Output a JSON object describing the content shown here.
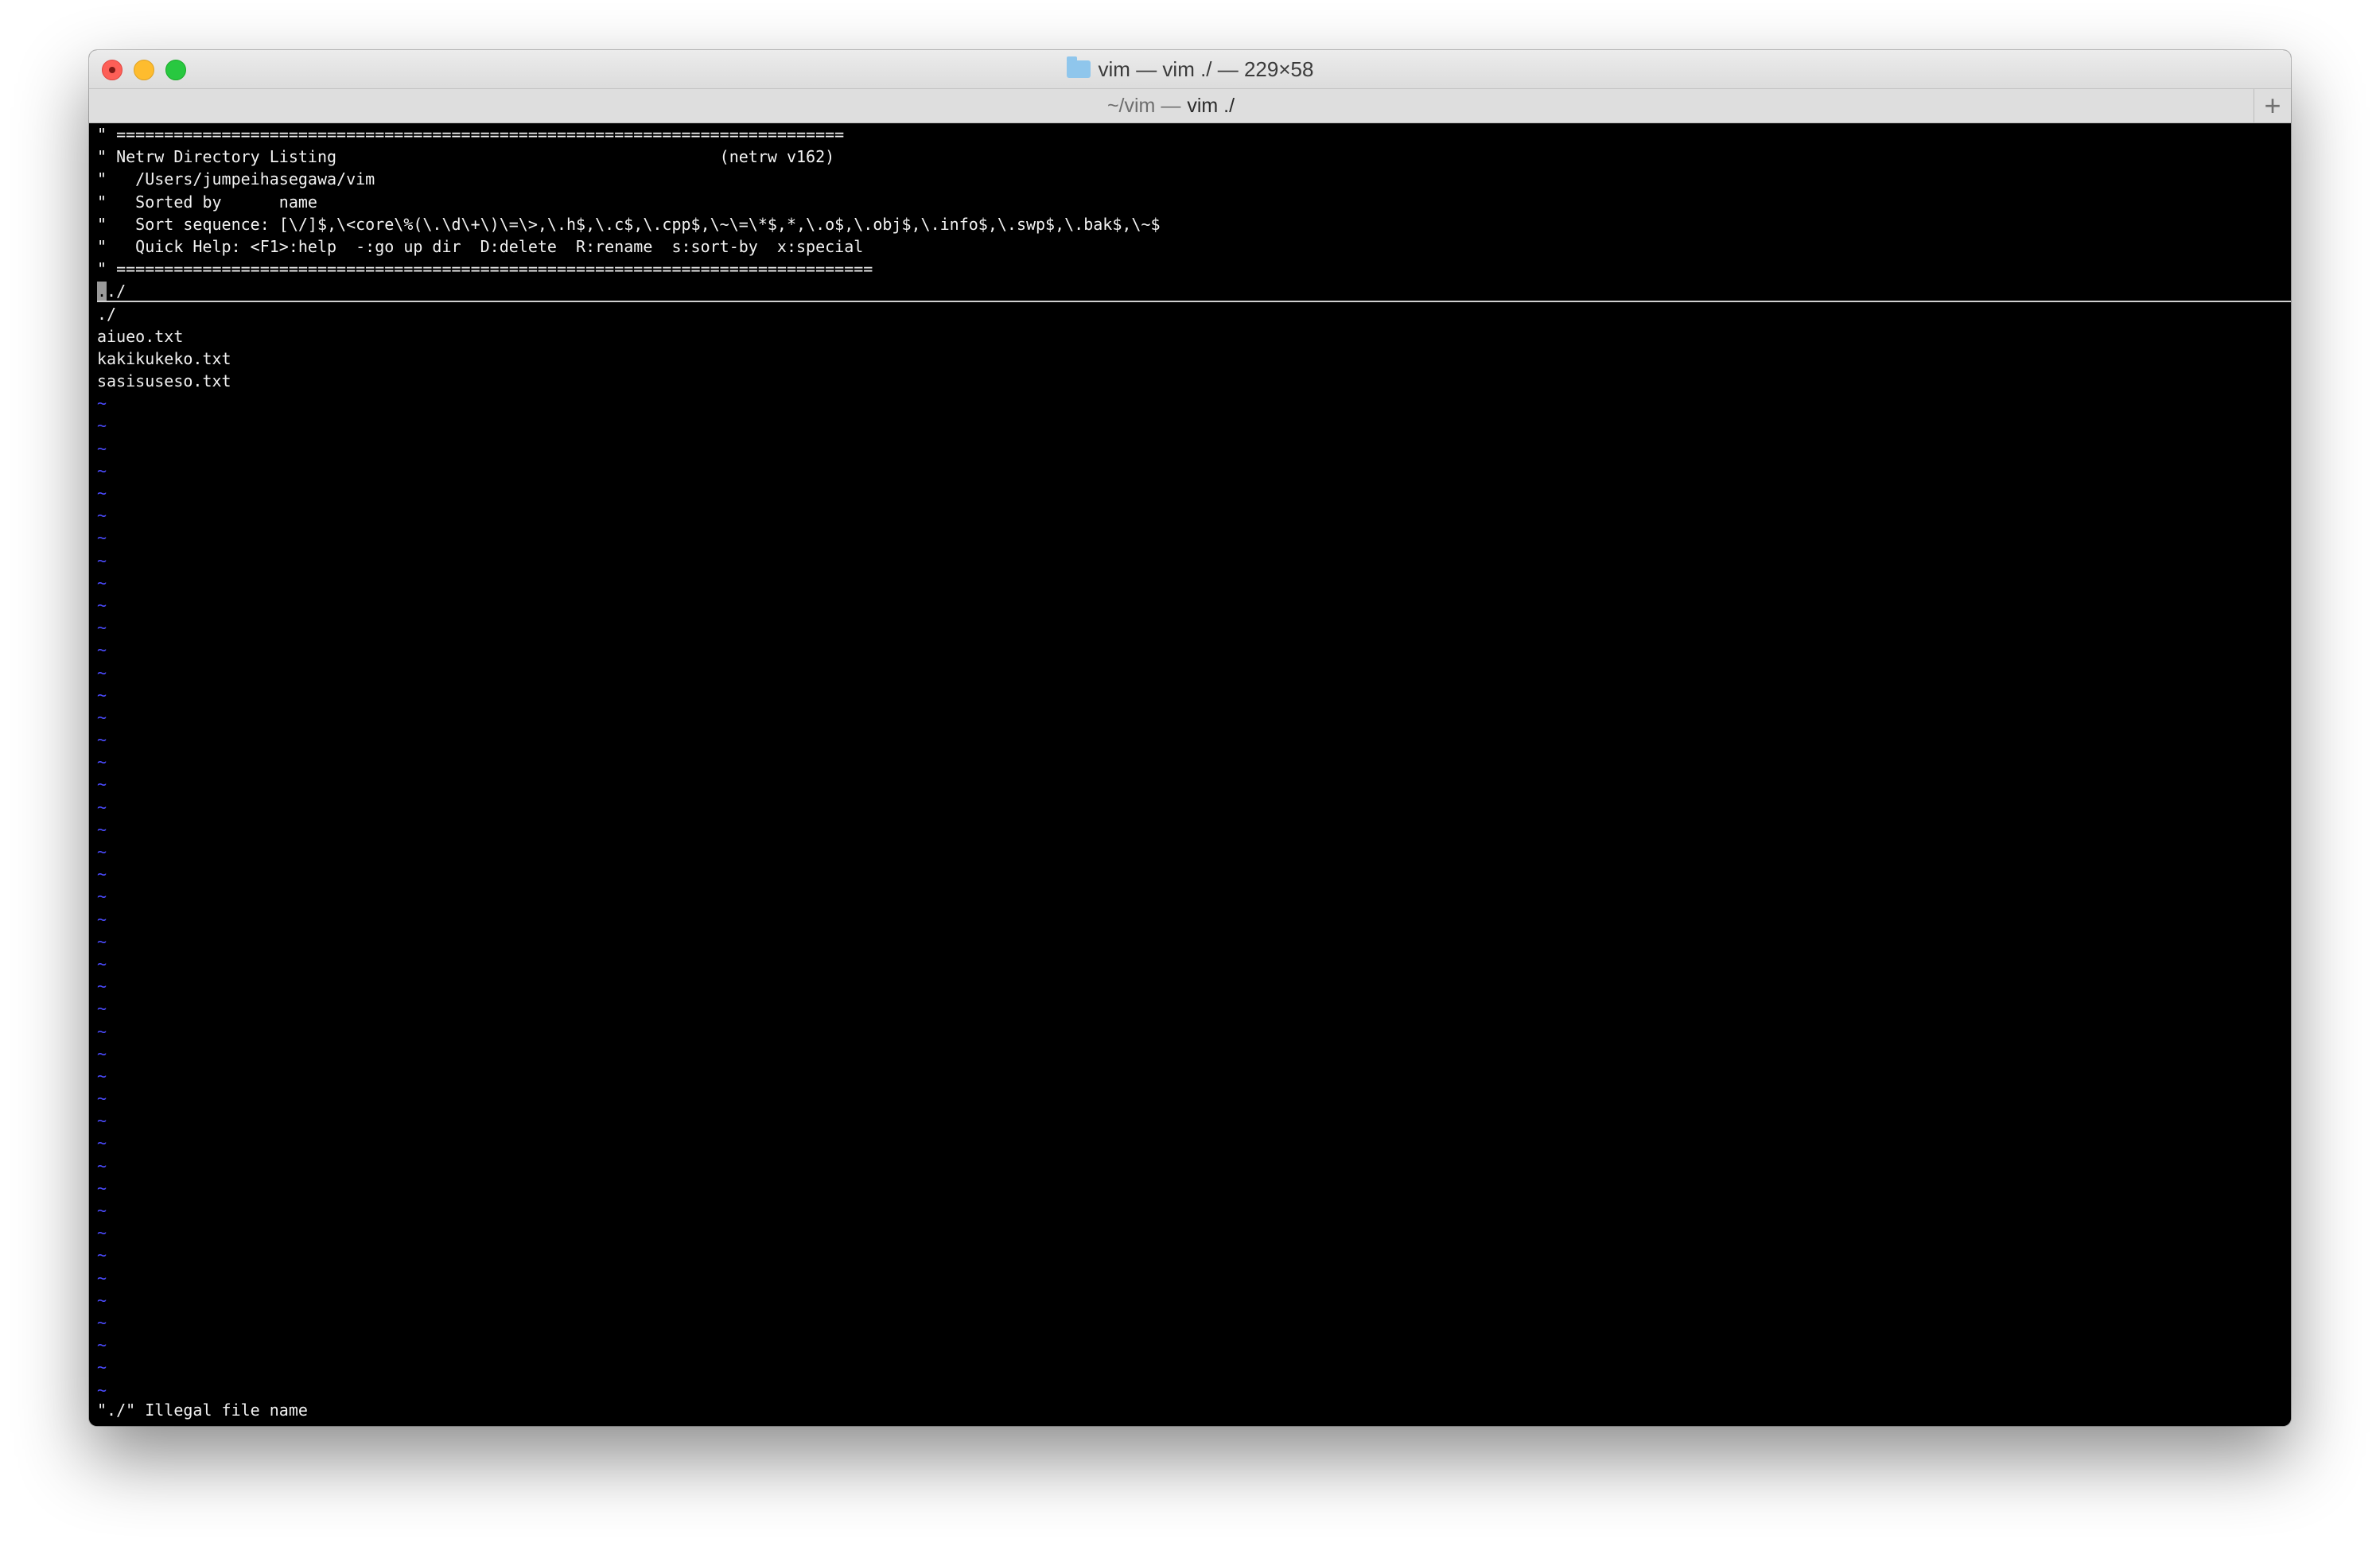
{
  "window": {
    "title": "vim — vim ./ — 229×58",
    "tab_prefix": "~/vim —",
    "tab_active": "vim ./",
    "new_tab_label": "+"
  },
  "netrw": {
    "header_lines": [
      "\" ============================================================================",
      "\" Netrw Directory Listing                                        (netrw v162)",
      "\"   /Users/jumpeihasegawa/vim",
      "\"   Sorted by      name",
      "\"   Sort sequence: [\\/]$,\\<core\\%(\\.\\d\\+\\)\\=\\>,\\.h$,\\.c$,\\.cpp$,\\~\\=\\*$,*,\\.o$,\\.obj$,\\.info$,\\.swp$,\\.bak$,\\~$",
      "\"   Quick Help: <F1>:help  -:go up dir  D:delete  R:rename  s:sort-by  x:special",
      "\" ==============================================================================="
    ],
    "cursor_char": ".",
    "cursor_rest": "./",
    "entries": [
      "./",
      "aiueo.txt",
      "kakikukeko.txt",
      "sasisuseso.txt"
    ],
    "tilde": "~",
    "tilde_count": 45
  },
  "status": {
    "message": "\"./\" Illegal file name"
  },
  "colors": {
    "terminal_bg": "#000000",
    "text": "#f0f0f0",
    "tilde": "#4a4afc"
  }
}
